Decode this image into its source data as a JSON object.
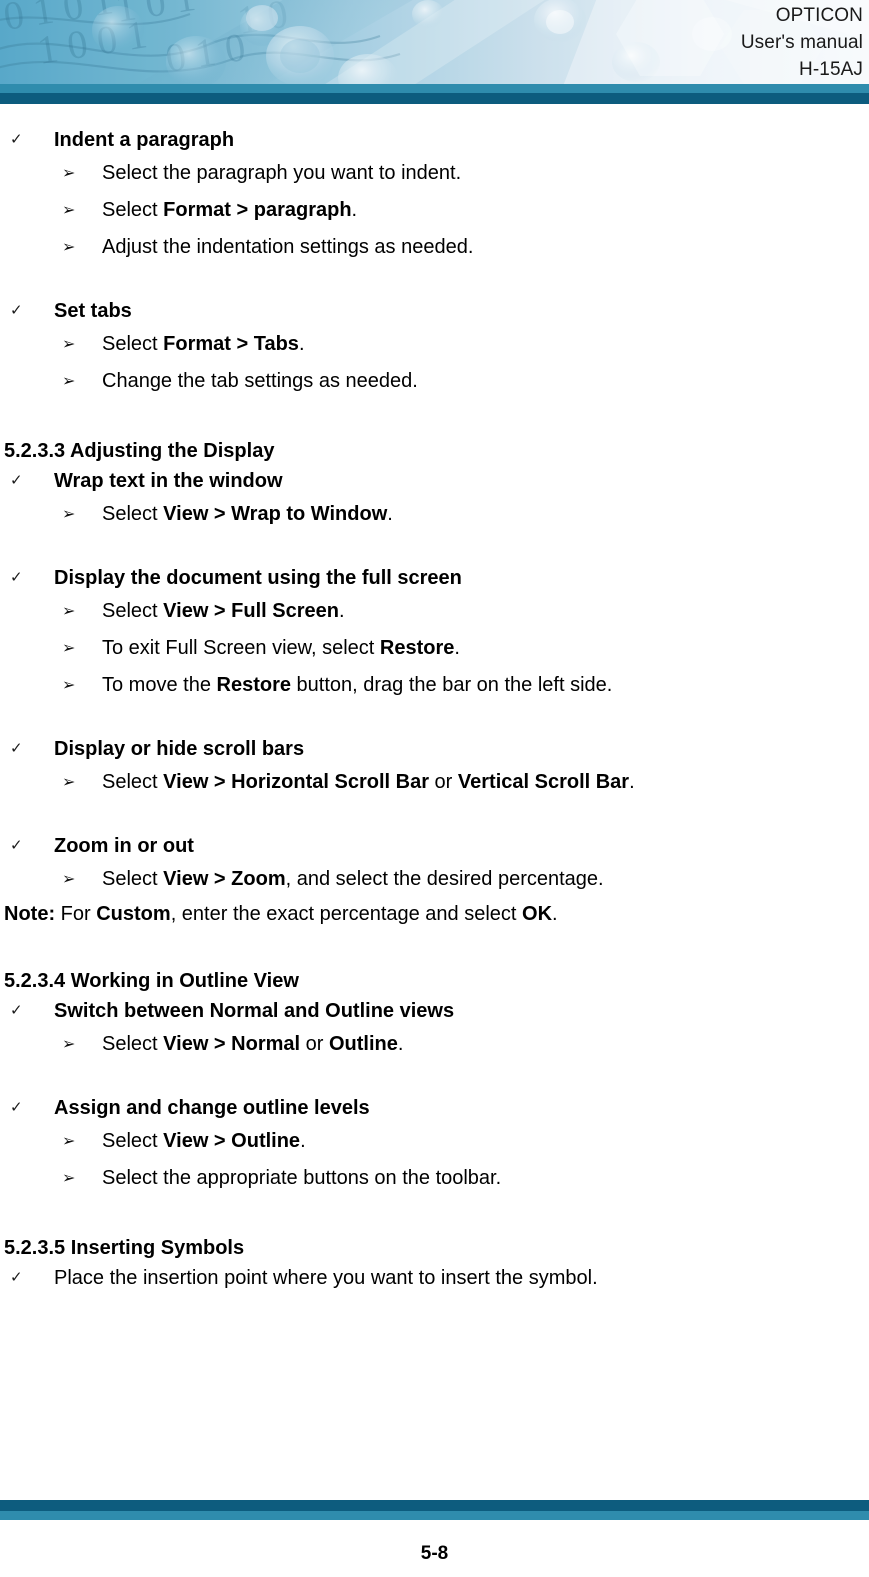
{
  "header": {
    "brand": "OPTICON",
    "doc_type": "User's manual",
    "model": "H-15AJ",
    "bar_light_color": "#2f8cad",
    "bar_dark_color": "#0d5c7e"
  },
  "bullets": {
    "level1_glyph": "✓",
    "level2_glyph": "➢"
  },
  "body": {
    "block1": {
      "heading": "Indent a paragraph",
      "items": [
        {
          "pre": "Select the paragraph you want to indent.",
          "bold": "",
          "post": ""
        },
        {
          "pre": "Select ",
          "bold": "Format > paragraph",
          "post": "."
        },
        {
          "pre": "Adjust the indentation settings as needed.",
          "bold": "",
          "post": ""
        }
      ]
    },
    "block2": {
      "heading": "Set tabs",
      "items": [
        {
          "pre": "Select ",
          "bold": "Format > Tabs",
          "post": "."
        },
        {
          "pre": "Change the tab settings as needed.",
          "bold": "",
          "post": ""
        }
      ]
    },
    "section_533": "5.2.3.3 Adjusting the Display",
    "block3": {
      "heading": "Wrap text in the window",
      "items": [
        {
          "pre": "Select ",
          "bold": "View > Wrap to Window",
          "post": "."
        }
      ]
    },
    "block4": {
      "heading": "Display the document using the full screen",
      "items": [
        {
          "pre": "Select ",
          "bold": "View > Full Screen",
          "post": "."
        },
        {
          "pre": "To exit Full Screen view, select ",
          "bold": "Restore",
          "post": "."
        },
        {
          "pre": "To move the ",
          "bold": "Restore",
          "post": " button, drag the bar on the left side."
        }
      ]
    },
    "block5": {
      "heading": "Display or hide scroll bars",
      "item_pre": "Select ",
      "item_bold1": "View > Horizontal Scroll Bar",
      "item_mid": " or ",
      "item_bold2": "Vertical Scroll Bar",
      "item_post": "."
    },
    "block6": {
      "heading": "Zoom in or out",
      "item_pre": "Select ",
      "item_bold": "View > Zoom",
      "item_post": ", and select the desired percentage."
    },
    "note": {
      "label": "Note:",
      "pre": " For ",
      "bold1": "Custom",
      "mid": ", enter the exact percentage and select ",
      "bold2": "OK",
      "post": "."
    },
    "section_534": "5.2.3.4 Working in Outline View",
    "block7": {
      "heading": "Switch between Normal and Outline views",
      "item_pre": "Select ",
      "item_bold1": "View > Normal",
      "item_mid": " or ",
      "item_bold2": "Outline",
      "item_post": "."
    },
    "block8": {
      "heading": "Assign and change outline levels",
      "items": [
        {
          "pre": "Select ",
          "bold": "View > Outline",
          "post": "."
        },
        {
          "pre": "Select the appropriate buttons on the toolbar.",
          "bold": "",
          "post": ""
        }
      ]
    },
    "section_535": "5.2.3.5 Inserting Symbols",
    "block9": {
      "item": "Place the insertion point where you want to insert the symbol."
    }
  },
  "footer": {
    "page_number": "5-8"
  }
}
